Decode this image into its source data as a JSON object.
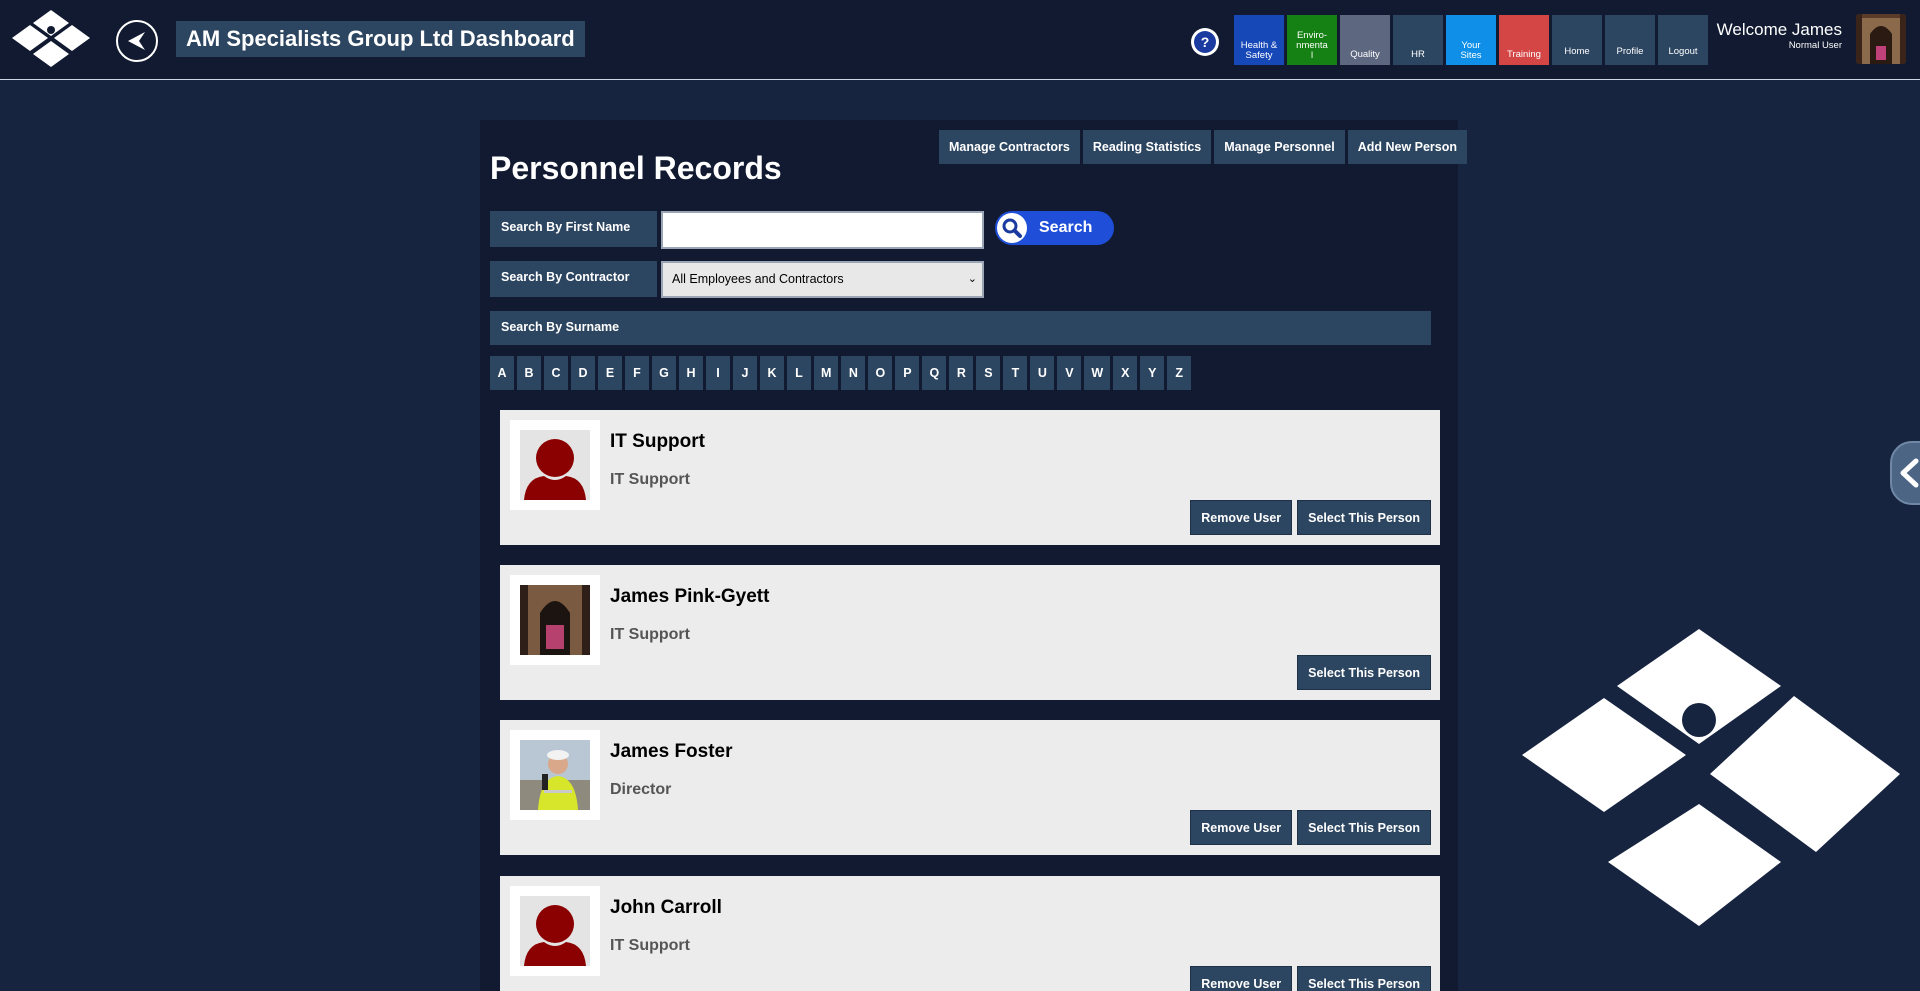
{
  "header": {
    "title": "AM Specialists Group Ltd Dashboard",
    "help_label": "?",
    "nav": [
      {
        "label": "Health & Safety",
        "color": "#1748b8"
      },
      {
        "label": "Enviro-nmental",
        "color": "#158013"
      },
      {
        "label": "Quality",
        "color": "#5d6880"
      },
      {
        "label": "HR",
        "color": "#2c4560"
      },
      {
        "label": "Your Sites",
        "color": "#0f8fe8"
      },
      {
        "label": "Training",
        "color": "#d44646"
      },
      {
        "label": "Home",
        "color": "#2c4560"
      },
      {
        "label": "Profile",
        "color": "#2c4560"
      },
      {
        "label": "Logout",
        "color": "#2c4560"
      }
    ],
    "welcome": "Welcome James",
    "user_role": "Normal User"
  },
  "main": {
    "title": "Personnel Records",
    "actions": [
      "Manage Contractors",
      "Reading Statistics",
      "Manage Personnel",
      "Add New Person"
    ],
    "search_first_name_label": "Search By First Name",
    "search_first_name_value": "",
    "search_button": "Search",
    "search_contractor_label": "Search By Contractor",
    "contractor_selected": "All Employees and Contractors",
    "search_surname_label": "Search By Surname",
    "letters": [
      "A",
      "B",
      "C",
      "D",
      "E",
      "F",
      "G",
      "H",
      "I",
      "J",
      "K",
      "L",
      "M",
      "N",
      "O",
      "P",
      "Q",
      "R",
      "S",
      "T",
      "U",
      "V",
      "W",
      "X",
      "Y",
      "Z"
    ]
  },
  "people": [
    {
      "name": "IT Support",
      "role": "IT Support",
      "photo": "placeholder",
      "remove": "Remove User",
      "select": "Select This Person"
    },
    {
      "name": "James Pink-Gyett",
      "role": "IT Support",
      "photo": "church",
      "select": "Select This Person"
    },
    {
      "name": "James Foster",
      "role": "Director",
      "photo": "hivis",
      "remove": "Remove User",
      "select": "Select This Person"
    },
    {
      "name": "John Carroll",
      "role": "IT Support",
      "photo": "placeholder",
      "remove": "Remove User",
      "select": "Select This Person"
    }
  ]
}
